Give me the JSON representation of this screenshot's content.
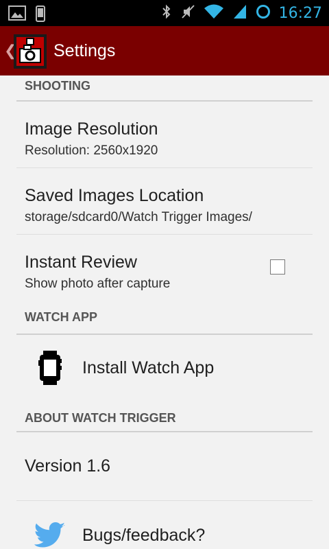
{
  "status_bar": {
    "time": "16:27",
    "icons": [
      "image-icon",
      "phone-icon",
      "bluetooth-icon",
      "vibrate-off-icon",
      "wifi-icon",
      "signal-icon",
      "sync-circle-icon"
    ]
  },
  "action_bar": {
    "up_glyph": "❮",
    "title": "Settings"
  },
  "sections": {
    "shooting": {
      "header": "SHOOTING",
      "image_resolution": {
        "title": "Image Resolution",
        "summary": "Resolution: 2560x1920"
      },
      "saved_location": {
        "title": "Saved Images Location",
        "summary": "storage/sdcard0/Watch Trigger Images/"
      },
      "instant_review": {
        "title": "Instant Review",
        "summary": "Show photo after capture",
        "checked": false
      }
    },
    "watch_app": {
      "header": "WATCH APP",
      "install": {
        "title": "Install Watch App",
        "icon": "watch-icon"
      }
    },
    "about": {
      "header": "ABOUT WATCH TRIGGER",
      "version": {
        "title": "Version 1.6"
      },
      "feedback": {
        "title": "Bugs/feedback?",
        "icon": "twitter-bird-icon"
      }
    }
  },
  "colors": {
    "action_bar": "#7a0000",
    "status_accent": "#33b5e5",
    "twitter": "#55acee"
  }
}
